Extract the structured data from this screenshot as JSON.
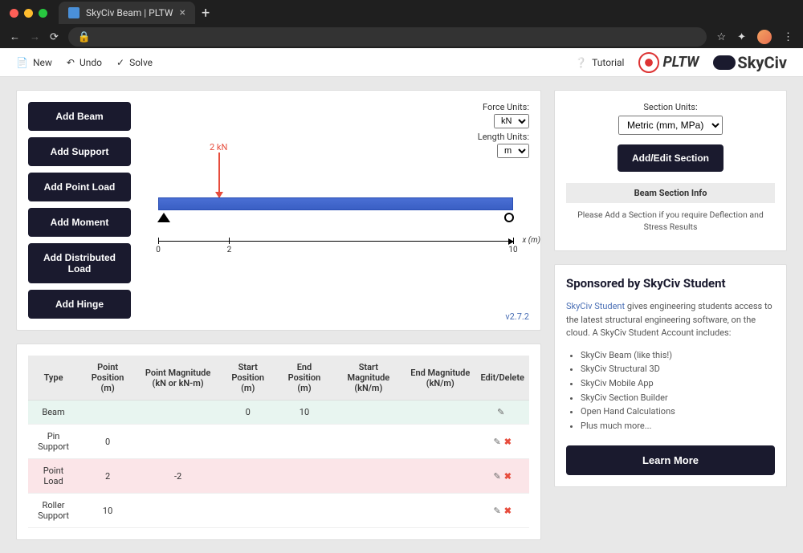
{
  "browser": {
    "tab_title": "SkyCiv Beam | PLTW",
    "new_tab": "+"
  },
  "topbar": {
    "new": "New",
    "undo": "Undo",
    "solve": "Solve",
    "tutorial": "Tutorial",
    "logo_pltw": "PLTW",
    "logo_skyciv": "SkyCiv"
  },
  "actions": {
    "add_beam": "Add Beam",
    "add_support": "Add Support",
    "add_point_load": "Add Point Load",
    "add_moment": "Add Moment",
    "add_distributed_load": "Add Distributed Load",
    "add_hinge": "Add Hinge"
  },
  "canvas": {
    "force_units_label": "Force Units:",
    "force_units_value": "kN",
    "length_units_label": "Length Units:",
    "length_units_value": "m",
    "load_label": "2 kN",
    "axis_label": "x (m)",
    "ticks": [
      "0",
      "2",
      "10"
    ],
    "version": "v2.7.2"
  },
  "table": {
    "headers": [
      "Type",
      "Point Position (m)",
      "Point Magnitude (kN or kN-m)",
      "Start Position (m)",
      "End Position (m)",
      "Start Magnitude (kN/m)",
      "End Magnitude (kN/m)",
      "Edit/Delete"
    ],
    "rows": [
      {
        "type": "Beam",
        "pp": "",
        "pm": "",
        "sp": "0",
        "ep": "10",
        "sm": "",
        "em": "",
        "edit": true,
        "del": false
      },
      {
        "type": "Pin Support",
        "pp": "0",
        "pm": "",
        "sp": "",
        "ep": "",
        "sm": "",
        "em": "",
        "edit": true,
        "del": true
      },
      {
        "type": "Point Load",
        "pp": "2",
        "pm": "-2",
        "sp": "",
        "ep": "",
        "sm": "",
        "em": "",
        "edit": true,
        "del": true
      },
      {
        "type": "Roller Support",
        "pp": "10",
        "pm": "",
        "sp": "",
        "ep": "",
        "sm": "",
        "em": "",
        "edit": true,
        "del": true
      }
    ]
  },
  "section": {
    "units_label": "Section Units:",
    "units_value": "Metric (mm, MPa)",
    "add_edit": "Add/Edit Section",
    "info_header": "Beam Section Info",
    "info_body": "Please Add a Section if you require Deflection and Stress Results"
  },
  "sponsor": {
    "title": "Sponsored by SkyCiv Student",
    "link_text": "SkyCiv Student",
    "desc": " gives engineering students access to the latest structural engineering software, on the cloud. A SkyCiv Student Account includes:",
    "items": [
      "SkyCiv Beam (like this!)",
      "SkyCiv Structural 3D",
      "SkyCiv Mobile App",
      "SkyCiv Section Builder",
      "Open Hand Calculations",
      "Plus much more..."
    ],
    "learn_more": "Learn More"
  },
  "chart_data": {
    "type": "beam-diagram",
    "beam_length": 10,
    "supports": [
      {
        "type": "pin",
        "position": 0
      },
      {
        "type": "roller",
        "position": 10
      }
    ],
    "point_loads": [
      {
        "position": 2,
        "magnitude": -2,
        "units": "kN"
      }
    ],
    "x_axis": {
      "label": "x (m)",
      "ticks": [
        0,
        2,
        10
      ]
    }
  }
}
